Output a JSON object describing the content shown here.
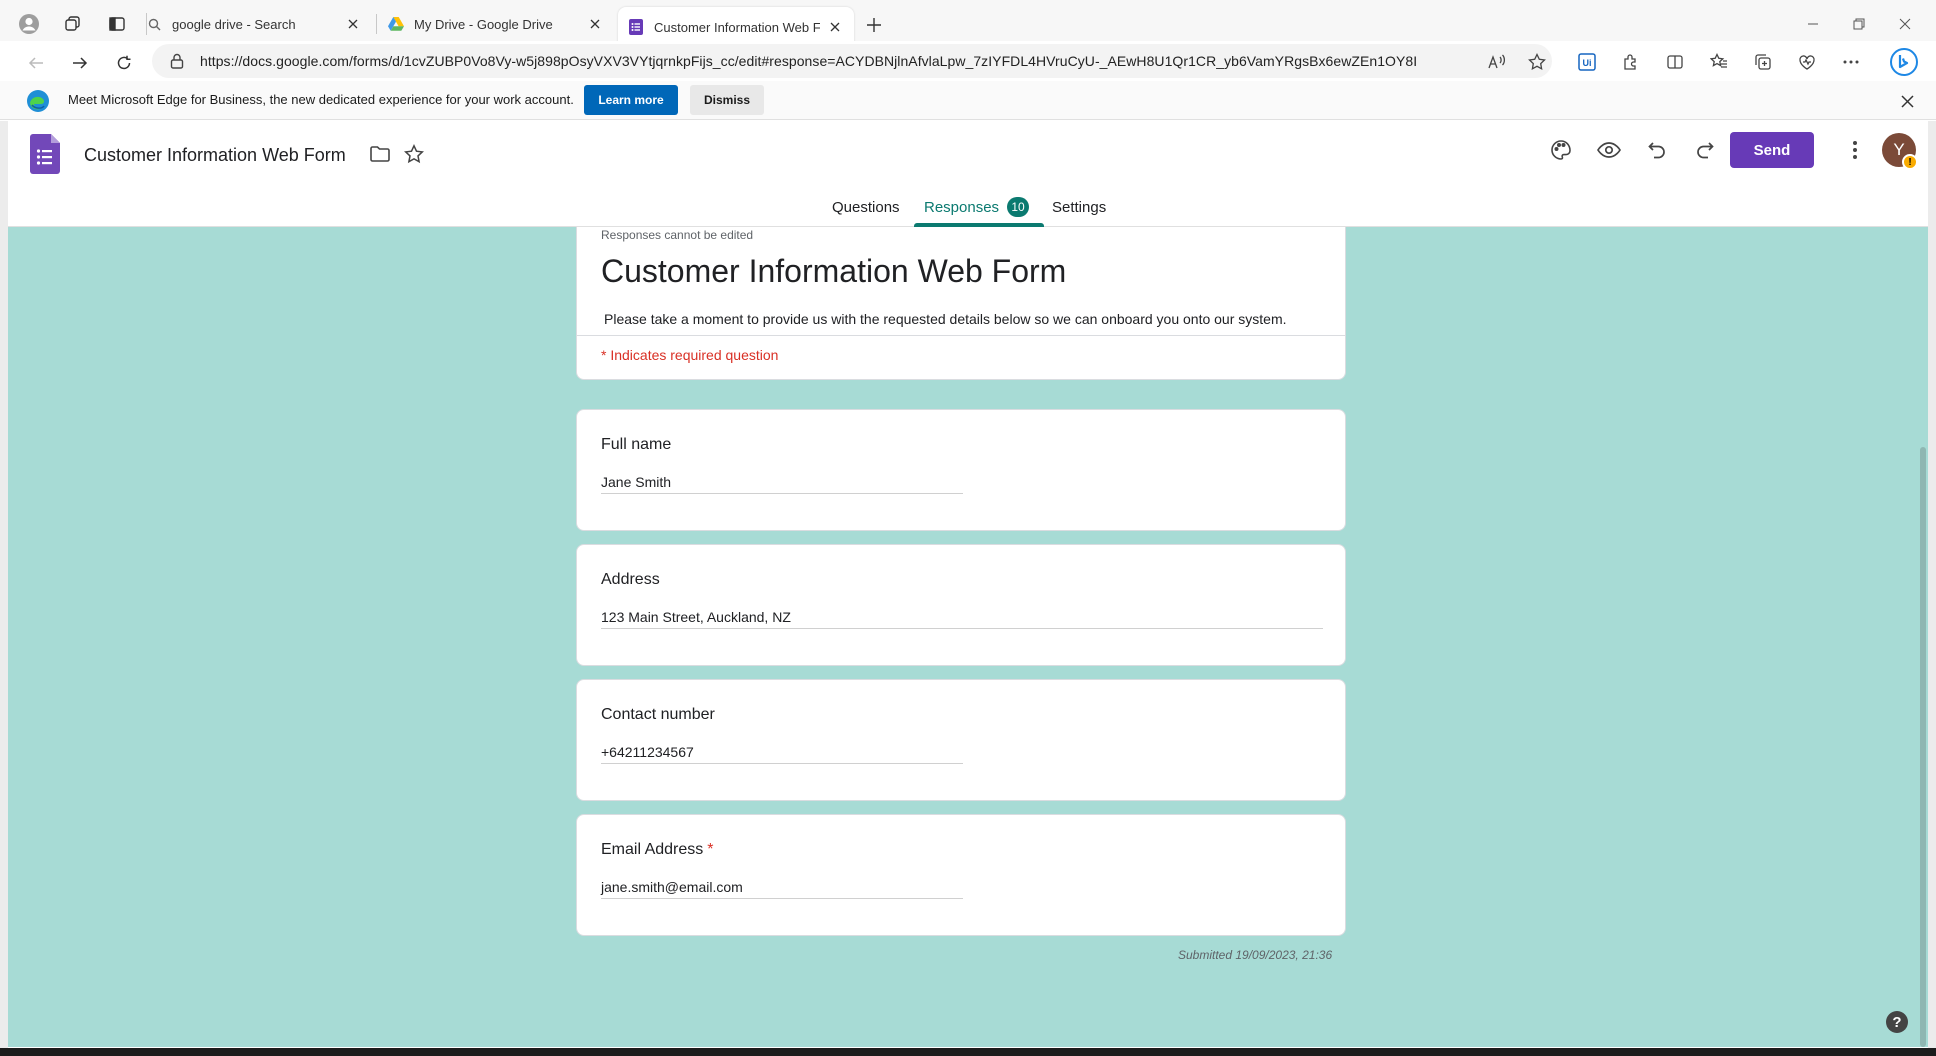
{
  "browser": {
    "tabs": [
      {
        "title": "google drive - Search",
        "icon": "search-icon"
      },
      {
        "title": "My Drive - Google Drive",
        "icon": "google-drive-icon"
      },
      {
        "title": "Customer Information Web Form",
        "icon": "google-forms-icon",
        "active": true
      }
    ],
    "url": "https://docs.google.com/forms/d/1cvZUBP0Vo8Vy-w5j898pOsyVXV3VYtjqrnkpFijs_cc/edit#response=ACYDBNjlnAfvlaLpw_7zIYFDL4HVruCyU-_AEwH8U1Qr1CR_yb6VamYRgsBx6ewZEn1OY8I"
  },
  "infobar": {
    "message": "Meet Microsoft Edge for Business, the new dedicated experience for your work account.",
    "learn_more": "Learn more",
    "dismiss": "Dismiss"
  },
  "form_header": {
    "title": "Customer Information Web Form",
    "send_label": "Send",
    "avatar_initial": "Y",
    "avatar_badge": "!",
    "tabs": {
      "questions": "Questions",
      "responses": "Responses",
      "responses_count": "10",
      "settings": "Settings"
    }
  },
  "form": {
    "note": "Responses cannot be edited",
    "title": "Customer Information Web Form",
    "description": "Please take a moment to provide us with the requested details below so we can onboard you onto our system.",
    "required_note": "* Indicates required question",
    "questions": [
      {
        "label": "Full name",
        "value": "Jane Smith",
        "required": false
      },
      {
        "label": "Address",
        "value": "123 Main Street, Auckland, NZ",
        "required": false
      },
      {
        "label": "Contact number",
        "value": "+64211234567",
        "required": false
      },
      {
        "label": "Email Address",
        "value": "jane.smith@email.com",
        "required": true,
        "required_mark": "*"
      }
    ],
    "submitted": "Submitted 19/09/2023, 21:36"
  },
  "help_label": "?",
  "colors": {
    "forms_purple": "#673ab7",
    "accent_teal": "#0b7a70",
    "canvas_bg": "#a7dbd5",
    "required_red": "#d93025",
    "edge_blue": "#0067b8"
  }
}
